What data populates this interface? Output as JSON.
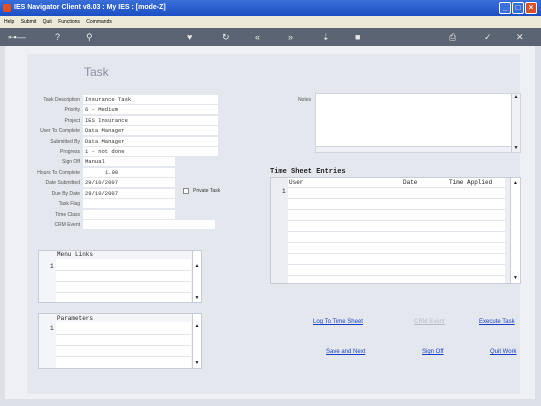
{
  "window": {
    "title": "IES Navigator Client v8.03 : My IES : [mode-Z]"
  },
  "menu": [
    "Help",
    "Submit",
    "Quit",
    "Functions",
    "Commands"
  ],
  "page": {
    "heading": "Task"
  },
  "fields": [
    {
      "label": "Task Description",
      "value": "Insurance Task"
    },
    {
      "label": "Priority",
      "value": "6 - Medium"
    },
    {
      "label": "Project",
      "value": "IES Insurance"
    },
    {
      "label": "User To Complete",
      "value": "Data Manager"
    },
    {
      "label": "Submitted By",
      "value": "Data Manager"
    },
    {
      "label": "Progress",
      "value": "1 - not done"
    },
    {
      "label": "Sign Off",
      "value": "Manual"
    },
    {
      "label": "Hours To Complete",
      "value": "1.00"
    },
    {
      "label": "Date Submitted",
      "value": "29/10/2007"
    },
    {
      "label": "Due By Date",
      "value": "29/10/2007"
    },
    {
      "label": "Task Flag",
      "value": ""
    },
    {
      "label": "Time Class",
      "value": ""
    },
    {
      "label": "CRM Event",
      "value": ""
    }
  ],
  "private_task": {
    "label": "Private Task",
    "checked": false
  },
  "notes": {
    "label": "Notes"
  },
  "timesheet": {
    "title": "Time Sheet Entries",
    "columns": [
      "User",
      "Date",
      "Time Applied"
    ],
    "row_number": "1"
  },
  "menu_links": {
    "title": "Menu Links",
    "row_number": "1"
  },
  "parameters": {
    "title": "Parameters",
    "row_number": "1"
  },
  "actions": {
    "log_time": "Log To Time Sheet",
    "crm_event": "CRM Event",
    "execute": "Execute Task",
    "save_next": "Save and Next",
    "sign_off": "Sign Off",
    "quit": "Quit Work"
  }
}
